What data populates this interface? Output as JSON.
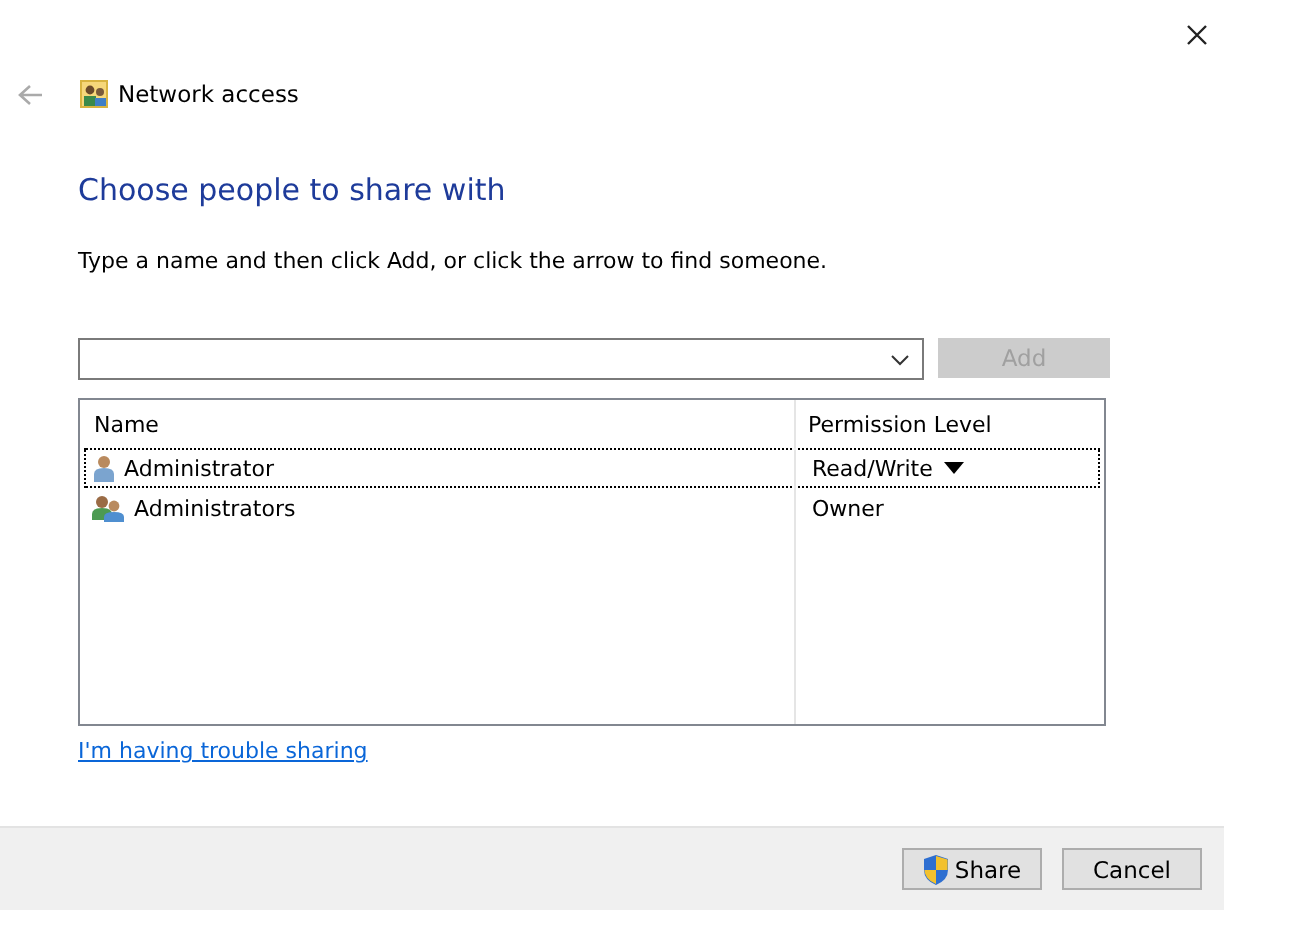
{
  "window": {
    "title": "Network access"
  },
  "heading": "Choose people to share with",
  "instruction": "Type a name and then click Add, or click the arrow to find someone.",
  "add_button": {
    "label": "Add",
    "disabled": true
  },
  "table": {
    "columns": [
      "Name",
      "Permission Level"
    ],
    "rows": [
      {
        "kind": "user",
        "name": "Administrator",
        "permission": "Read/Write",
        "selected": true
      },
      {
        "kind": "group",
        "name": "Administrators",
        "permission": "Owner",
        "selected": false
      }
    ]
  },
  "help_link": "I'm having trouble sharing",
  "buttons": [
    {
      "kind": "shield",
      "label": "Share"
    },
    {
      "kind": "plain",
      "label": "Cancel"
    }
  ]
}
